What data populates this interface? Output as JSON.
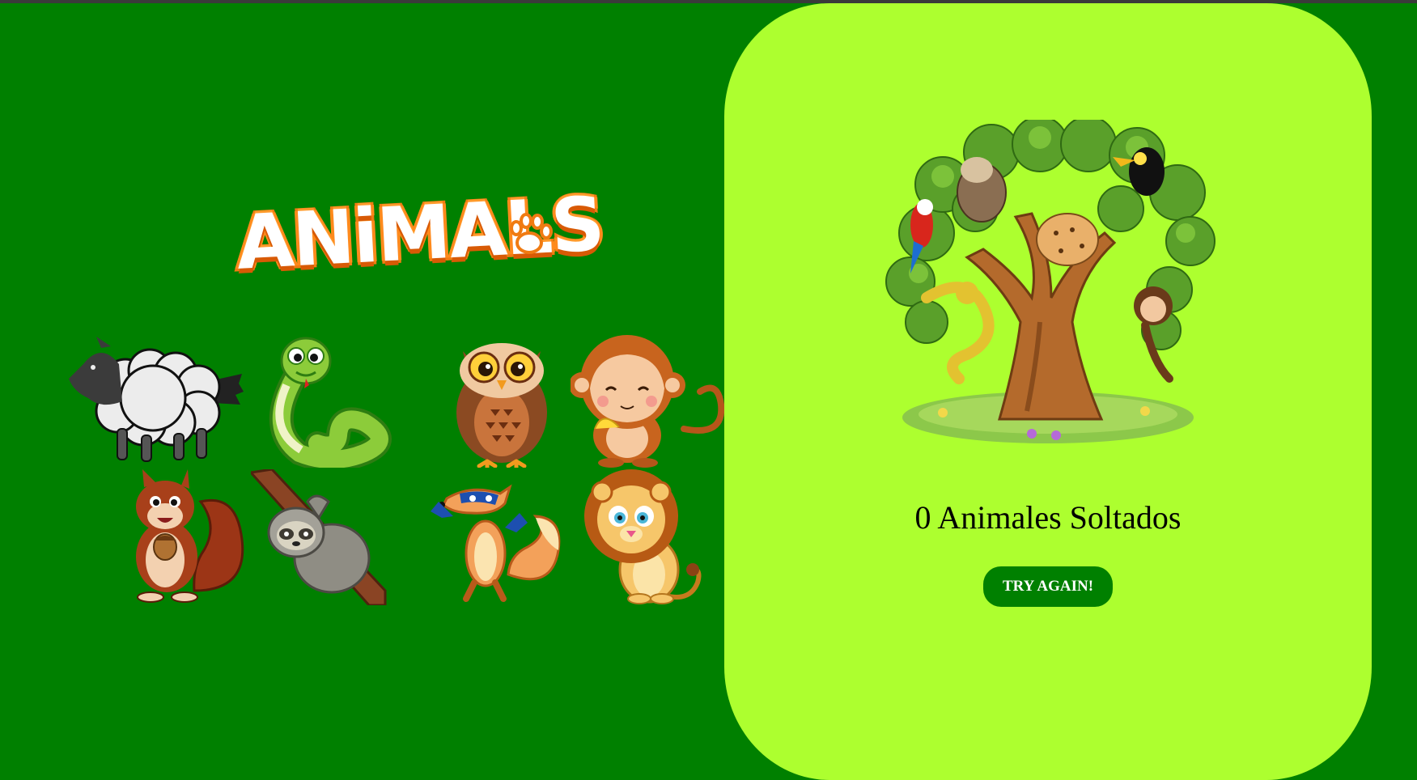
{
  "app": {
    "logo_text": "ANiMALS",
    "background_color": "#008000",
    "panel_color": "#adff2f"
  },
  "animals": [
    {
      "name": "sheep",
      "icon": "sheep-icon"
    },
    {
      "name": "snake",
      "icon": "snake-icon"
    },
    {
      "name": "owl",
      "icon": "owl-icon"
    },
    {
      "name": "monkey",
      "icon": "monkey-icon"
    },
    {
      "name": "squirrel",
      "icon": "squirrel-icon"
    },
    {
      "name": "sloth",
      "icon": "sloth-icon"
    },
    {
      "name": "fox",
      "icon": "fox-icon"
    },
    {
      "name": "lion",
      "icon": "lion-icon"
    }
  ],
  "dropzone": {
    "image": "jungle-tree-icon",
    "counter_text": "0 Animales Soltados",
    "counter_value": 0,
    "try_again_label": "TRY AGAIN!"
  }
}
